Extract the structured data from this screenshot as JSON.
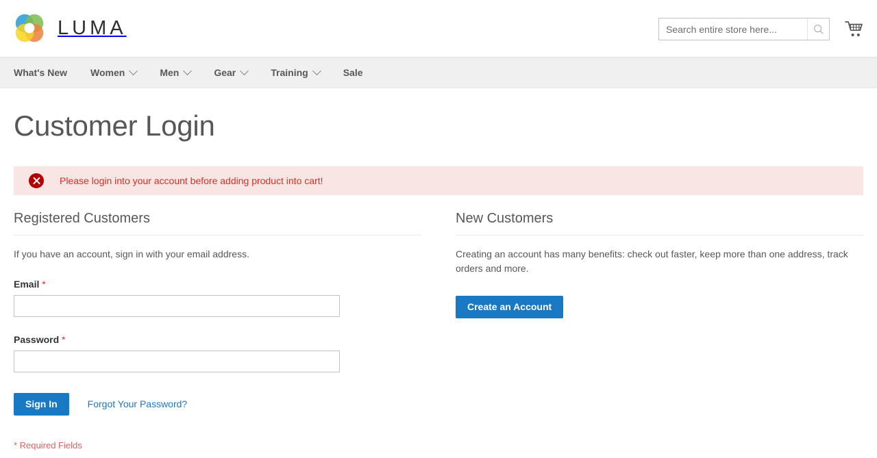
{
  "header": {
    "logo_text": "LUMA",
    "logo_icon": "luma-flower-logo",
    "search": {
      "placeholder": "Search entire store here...",
      "value": "",
      "icon": "search-icon"
    },
    "cart": {
      "icon": "shopping-cart-icon",
      "label": "My Cart"
    }
  },
  "nav": {
    "items": [
      {
        "label": "What's New",
        "has_dropdown": false
      },
      {
        "label": "Women",
        "has_dropdown": true
      },
      {
        "label": "Men",
        "has_dropdown": true
      },
      {
        "label": "Gear",
        "has_dropdown": true
      },
      {
        "label": "Training",
        "has_dropdown": true
      },
      {
        "label": "Sale",
        "has_dropdown": false
      }
    ]
  },
  "page": {
    "title": "Customer Login"
  },
  "message": {
    "type": "error",
    "icon": "error-circle-x-icon",
    "text": "Please login into your account before adding product into cart!"
  },
  "registered": {
    "title": "Registered Customers",
    "note": "If you have an account, sign in with your email address.",
    "email_label": "Email",
    "email_value": "",
    "password_label": "Password",
    "password_value": "",
    "required_star": "*",
    "signin_label": "Sign In",
    "forgot_label": "Forgot Your Password?"
  },
  "new_customers": {
    "title": "New Customers",
    "note": "Creating an account has many benefits: check out faster, keep more than one address, track orders and more.",
    "create_label": "Create an Account"
  },
  "footer_note": {
    "required_fields": "* Required Fields"
  },
  "colors": {
    "primary_blue": "#1979c3",
    "error_text": "#e02b27",
    "error_bg": "#fae5e5",
    "error_icon": "#b30000",
    "nav_bg": "#f0f0f0",
    "required_note": "#e36161"
  }
}
